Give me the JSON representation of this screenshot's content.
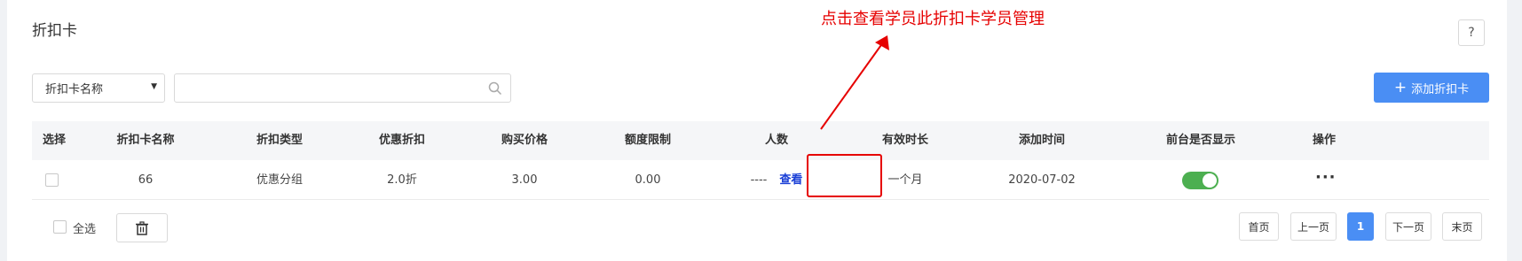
{
  "page": {
    "title": "折扣卡",
    "help_label": "?"
  },
  "filter": {
    "select_value": "折扣卡名称",
    "search_value": ""
  },
  "toolbar": {
    "add_label": "添加折扣卡"
  },
  "table": {
    "headers": [
      "选择",
      "折扣卡名称",
      "折扣类型",
      "优惠折扣",
      "购买价格",
      "额度限制",
      "人数",
      "有效时长",
      "添加时间",
      "前台是否显示",
      "操作"
    ],
    "rows": [
      {
        "name": "66",
        "type": "优惠分组",
        "discount": "2.0折",
        "price": "3.00",
        "limit": "0.00",
        "members": "----",
        "view_label": "查看",
        "duration": "一个月",
        "added": "2020-07-02",
        "show_on_front": true,
        "ops": "···"
      }
    ]
  },
  "footer": {
    "select_all_label": "全选"
  },
  "pagination": {
    "first": "首页",
    "prev": "上一页",
    "current": "1",
    "next": "下一页",
    "last": "末页"
  },
  "annotation": {
    "text": "点击查看学员此折扣卡学员管理",
    "color": "#e60000"
  },
  "colors": {
    "accent": "#4a8ef4",
    "toggle_on": "#4caf50",
    "link": "#1a3fd6"
  }
}
